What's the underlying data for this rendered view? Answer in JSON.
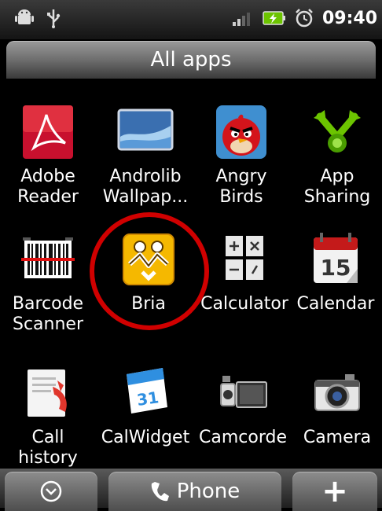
{
  "status_bar": {
    "time": "09:40"
  },
  "title": "All apps",
  "apps": [
    {
      "label": "Adobe\nReader",
      "icon": "adobe-reader-icon"
    },
    {
      "label": "Androlib\nWallpap...",
      "icon": "androlib-wallpapers-icon"
    },
    {
      "label": "Angry\nBirds",
      "icon": "angry-birds-icon"
    },
    {
      "label": "App\nSharing",
      "icon": "app-sharing-icon"
    },
    {
      "label": "Barcode\nScanner",
      "icon": "barcode-scanner-icon"
    },
    {
      "label": "Bria",
      "icon": "bria-icon"
    },
    {
      "label": "Calculator",
      "icon": "calculator-icon"
    },
    {
      "label": "Calendar",
      "icon": "calendar-icon"
    },
    {
      "label": "Call\nhistory",
      "icon": "call-history-icon"
    },
    {
      "label": "CalWidget",
      "icon": "calwidget-icon"
    },
    {
      "label": "Camcorde",
      "icon": "camcorder-icon"
    },
    {
      "label": "Camera",
      "icon": "camera-icon"
    }
  ],
  "icon_text": {
    "calendar_day": "15",
    "calwidget_day": "31"
  },
  "dock": {
    "phone_label": "Phone",
    "add_glyph": "+"
  },
  "colors": {
    "highlight": "#d00000",
    "accent_green": "#6cc400"
  }
}
